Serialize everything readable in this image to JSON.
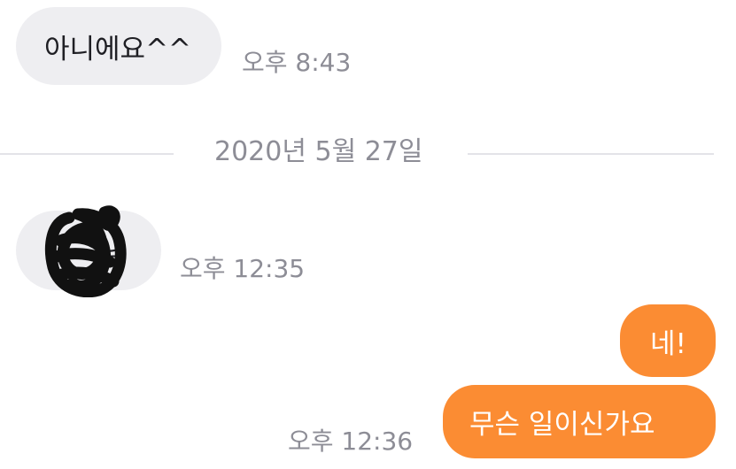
{
  "messages": [
    {
      "direction": "incoming",
      "text": "아니에요^^",
      "time": "오후 8:43"
    },
    {
      "direction": "incoming",
      "sender_suffix": "님",
      "sender_name": "redacted scribble",
      "time": "오후 12:35"
    },
    {
      "direction": "outgoing",
      "text": "네!"
    },
    {
      "direction": "outgoing",
      "text": "무슨 일이신가요",
      "time": "오후 12:36"
    }
  ],
  "date_divider": "2020년 5월 27일",
  "colors": {
    "incoming_bubble": "#eeeef1",
    "outgoing_bubble": "#fb8c33",
    "timestamp": "#8d8d96",
    "divider_line": "#e3e3e8"
  }
}
